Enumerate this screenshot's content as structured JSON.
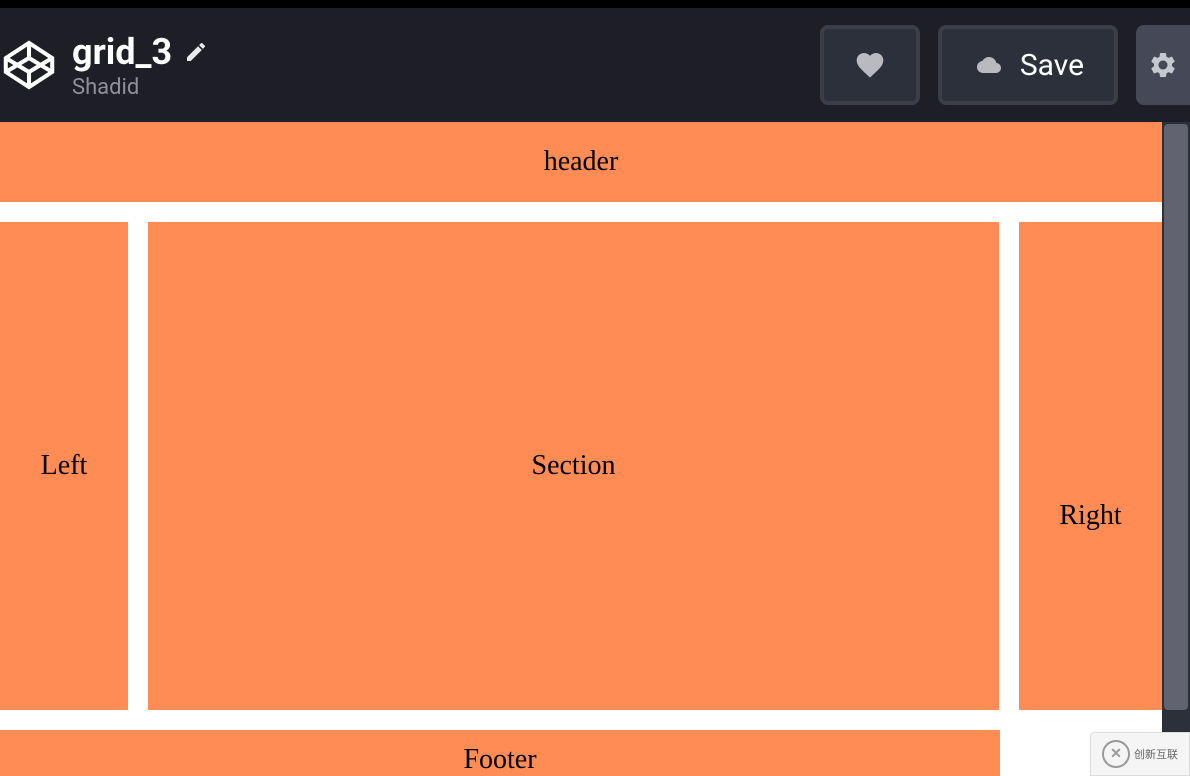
{
  "header": {
    "title": "grid_3",
    "author": "Shadid",
    "save_label": "Save"
  },
  "preview": {
    "header_text": "header",
    "left_text": "Left",
    "section_text": "Section",
    "right_text": "Right",
    "footer_text": "Footer"
  },
  "watermark": {
    "text": "创新互联"
  },
  "colors": {
    "grid_bg": "#ff8c55",
    "topbar_bg": "#1e1f26",
    "btn_bg": "#2c303a"
  }
}
